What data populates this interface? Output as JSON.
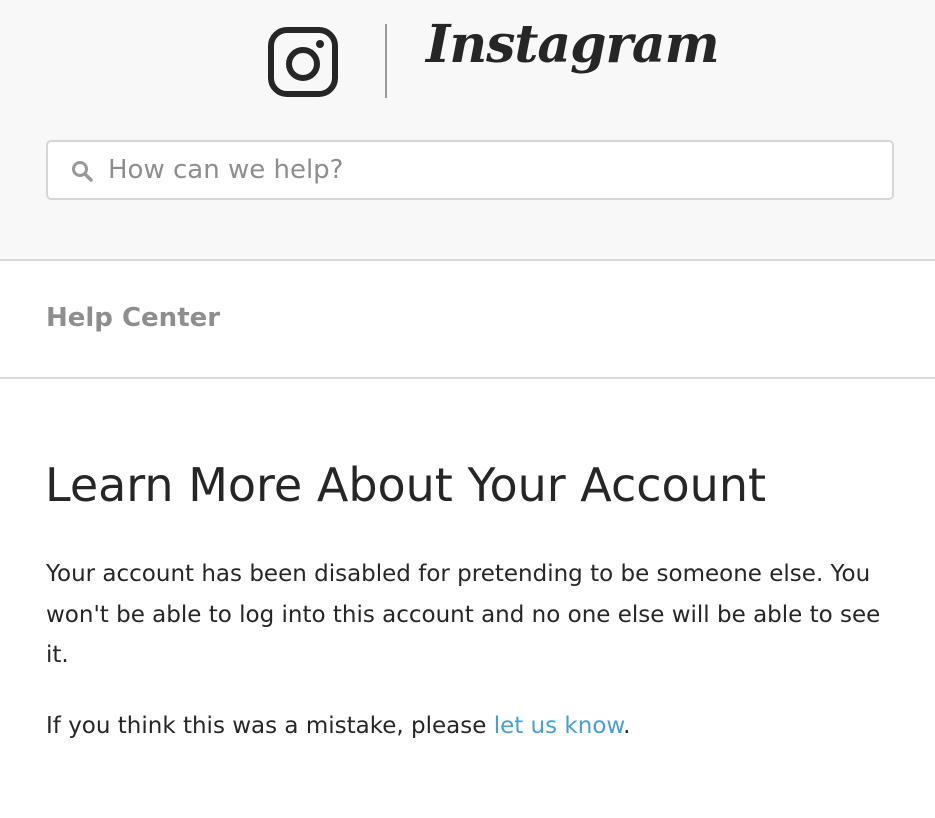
{
  "brand": {
    "name": "Instagram",
    "glyph_icon": "instagram-camera-icon"
  },
  "search": {
    "placeholder": "How can we help?",
    "value": "",
    "icon": "search-icon"
  },
  "breadcrumb": {
    "label": "Help Center"
  },
  "article": {
    "title": "Learn More About Your Account",
    "paragraph1": "Your account has been disabled for pretending to be someone else. You won't be able to log into this account and no one else will be able to see it.",
    "paragraph2_prefix": "If you think this was a mistake, please ",
    "paragraph2_link": "let us know",
    "paragraph2_suffix": "."
  },
  "colors": {
    "header_bg": "#f8f8f8",
    "text": "#262626",
    "muted": "#8e8e8e",
    "link": "#4a9fd0",
    "border": "#d9d9d9"
  }
}
